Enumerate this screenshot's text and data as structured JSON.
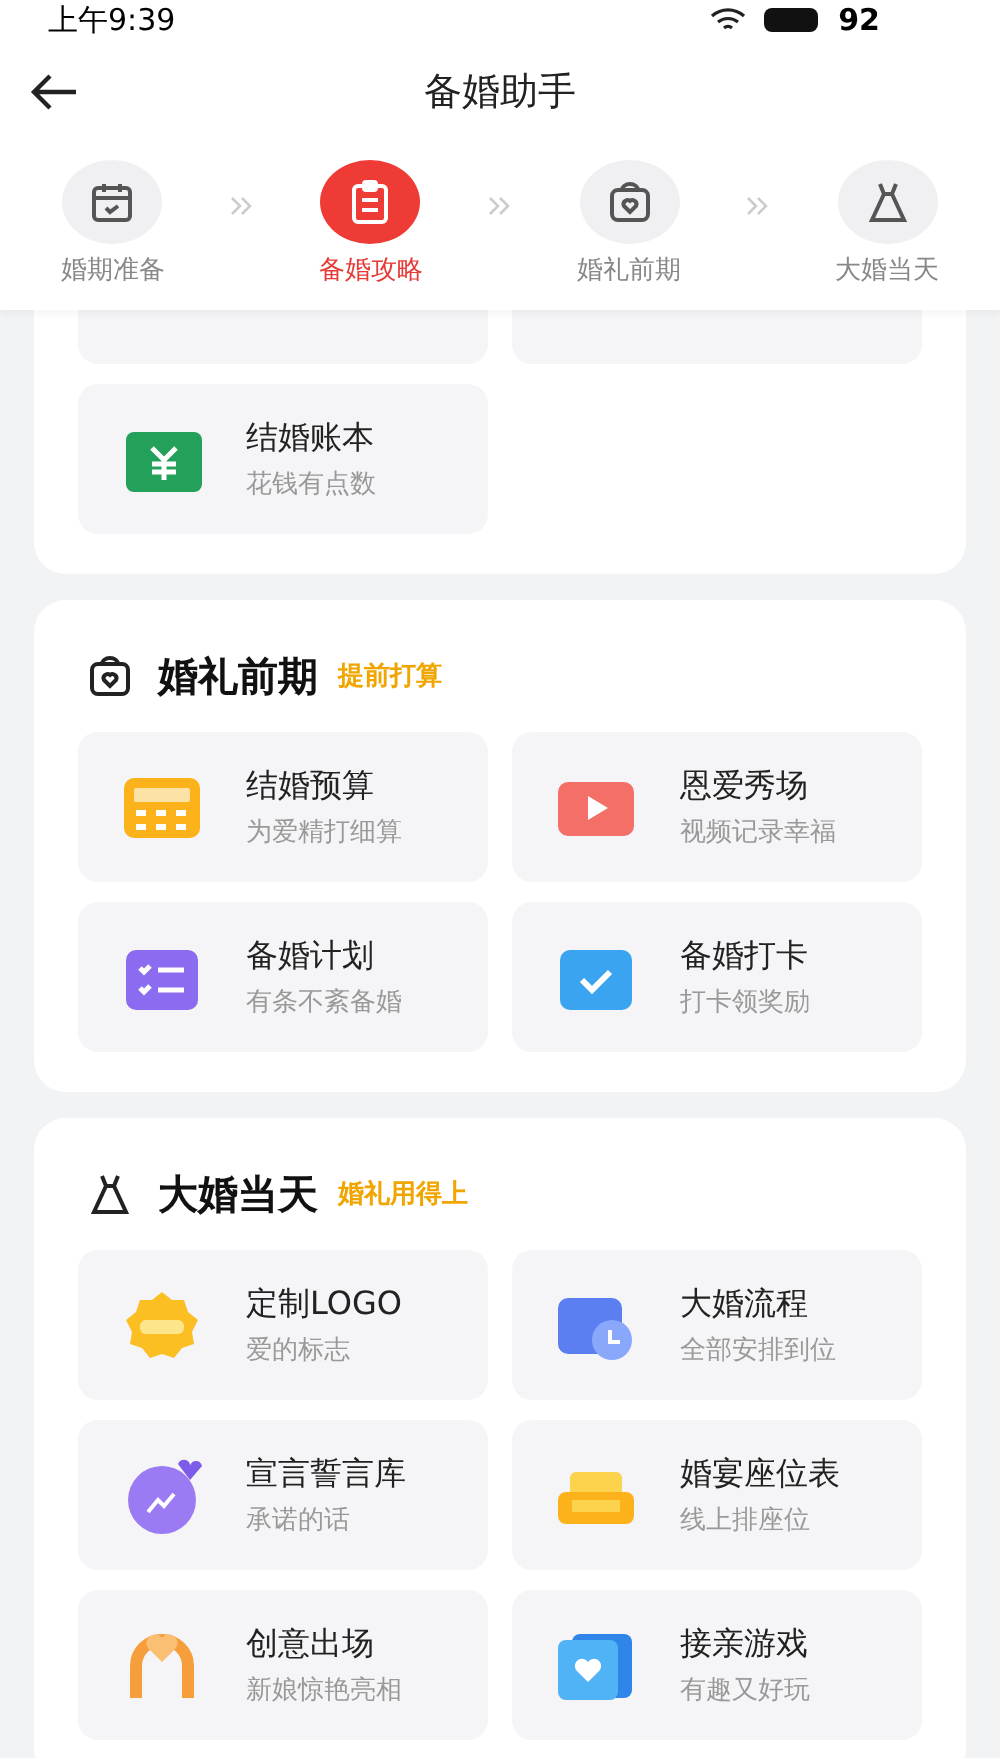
{
  "status_bar": {
    "time": "上午9:39",
    "battery": "92"
  },
  "header": {
    "title": "备婚助手"
  },
  "steps": [
    {
      "label": "婚期准备",
      "selected": false
    },
    {
      "label": "备婚攻略",
      "selected": true
    },
    {
      "label": "婚礼前期",
      "selected": false
    },
    {
      "label": "大婚当天",
      "selected": false
    }
  ],
  "top_section": {
    "items": [
      {
        "title": "结婚账本",
        "subtitle": "花钱有点数"
      }
    ]
  },
  "sections": [
    {
      "title": "婚礼前期",
      "tag": "提前打算",
      "items": [
        {
          "title": "结婚预算",
          "subtitle": "为爱精打细算"
        },
        {
          "title": "恩爱秀场",
          "subtitle": "视频记录幸福"
        },
        {
          "title": "备婚计划",
          "subtitle": "有条不紊备婚"
        },
        {
          "title": "备婚打卡",
          "subtitle": "打卡领奖励"
        }
      ]
    },
    {
      "title": "大婚当天",
      "tag": "婚礼用得上",
      "items": [
        {
          "title": "定制LOGO",
          "subtitle": "爱的标志"
        },
        {
          "title": "大婚流程",
          "subtitle": "全部安排到位"
        },
        {
          "title": "宣言誓言库",
          "subtitle": "承诺的话"
        },
        {
          "title": "婚宴座位表",
          "subtitle": "线上排座位"
        },
        {
          "title": "创意出场",
          "subtitle": "新娘惊艳亮相"
        },
        {
          "title": "接亲游戏",
          "subtitle": "有趣又好玩"
        }
      ]
    }
  ]
}
